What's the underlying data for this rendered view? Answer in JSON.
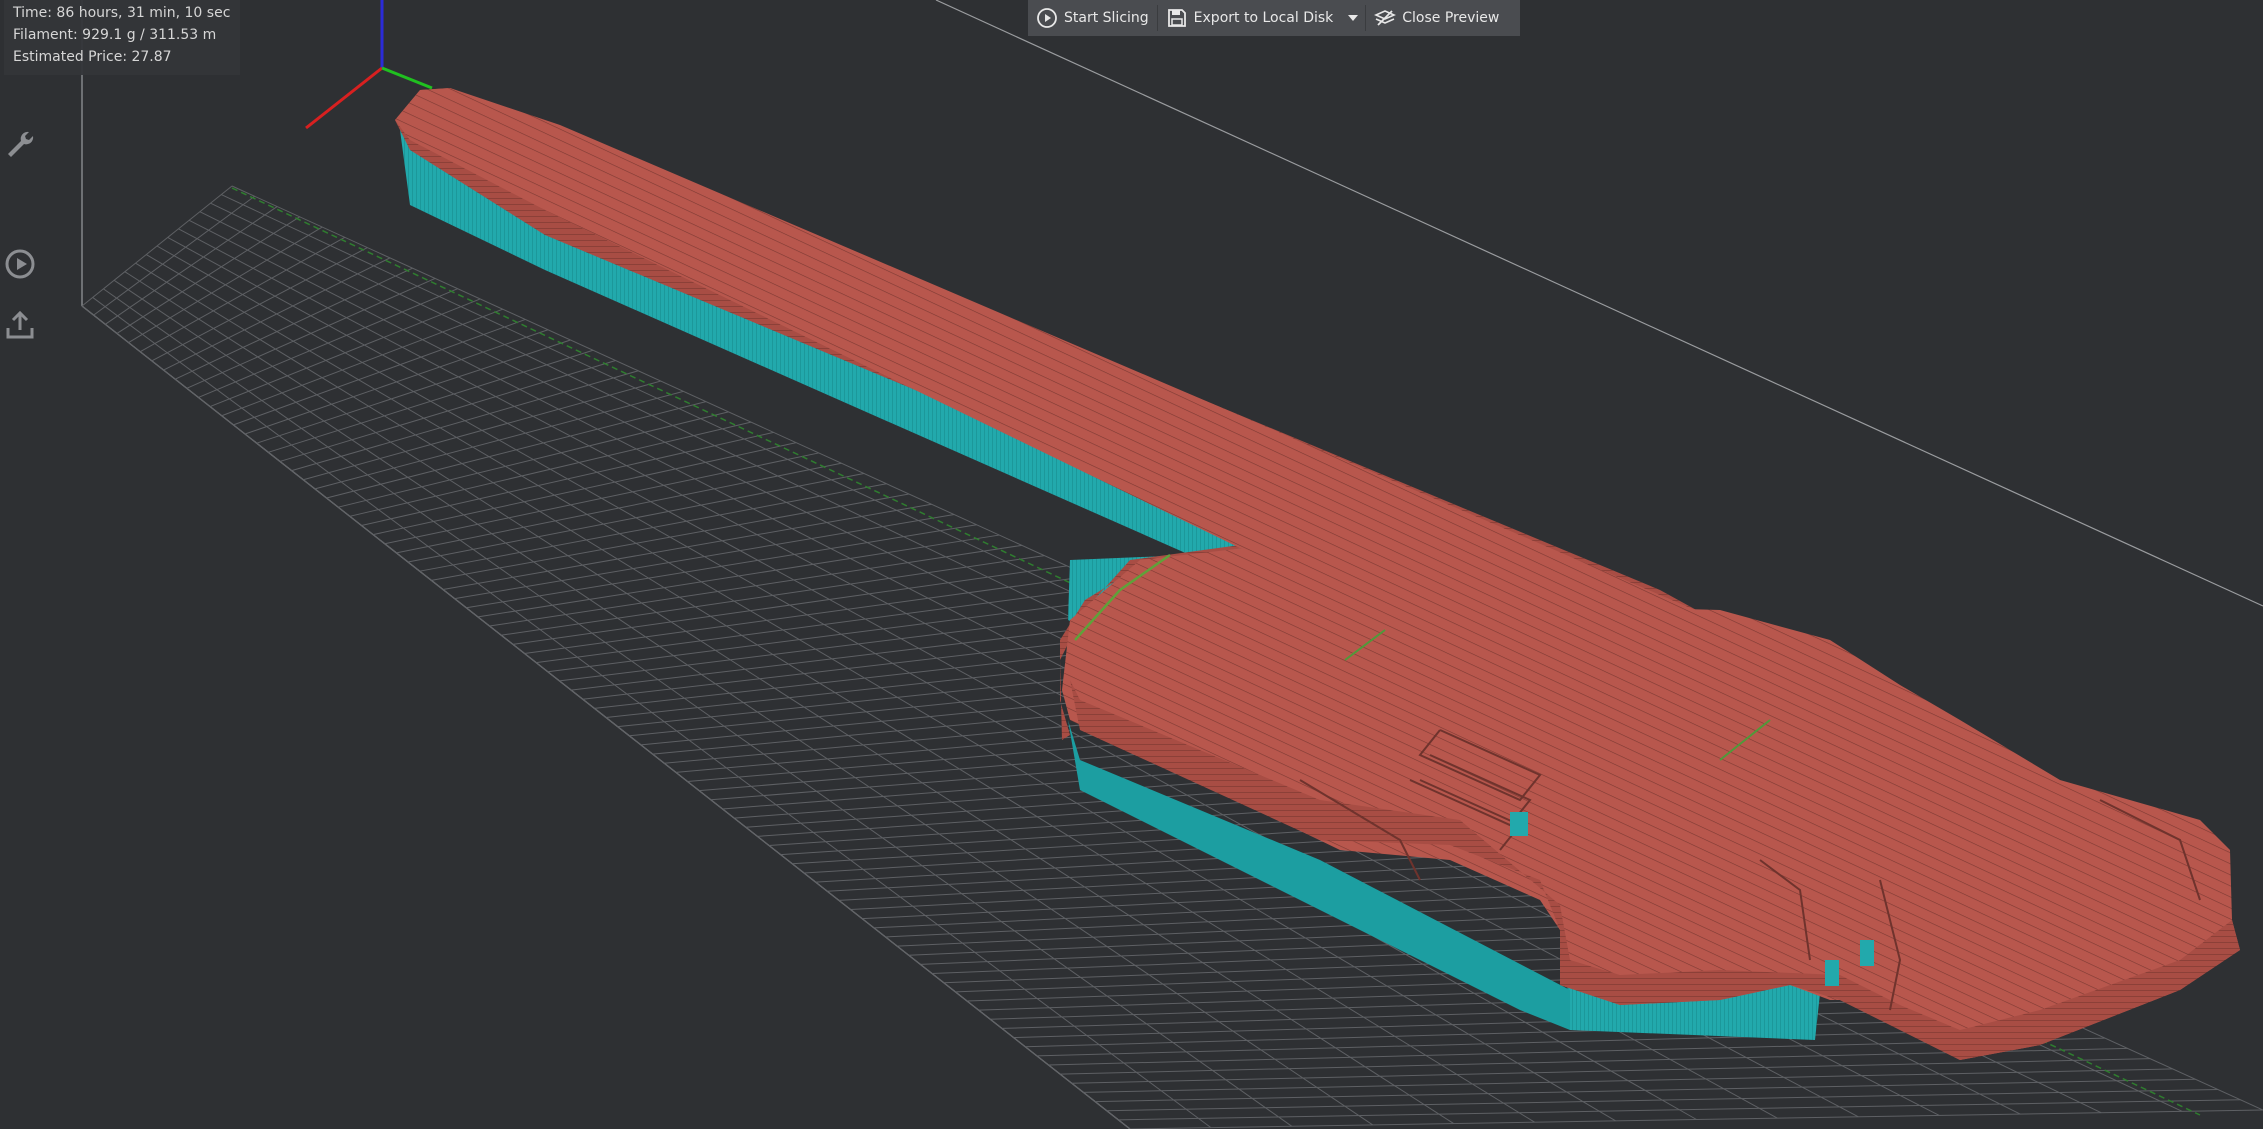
{
  "stats": {
    "time": "Time: 86 hours, 31 min, 10 sec",
    "filament": "Filament: 929.1 g / 311.53 m",
    "price": "Estimated Price: 27.87"
  },
  "toolbar": {
    "start_slicing": "Start Slicing",
    "export": "Export to Local Disk",
    "close_preview": "Close Preview"
  },
  "side_tools": [
    "wrench-icon",
    "play-icon",
    "upload-icon"
  ],
  "colors": {
    "background": "#2e3033",
    "model": "#b8574d",
    "support": "#1ea3a6",
    "grid": "#8a8c90"
  }
}
